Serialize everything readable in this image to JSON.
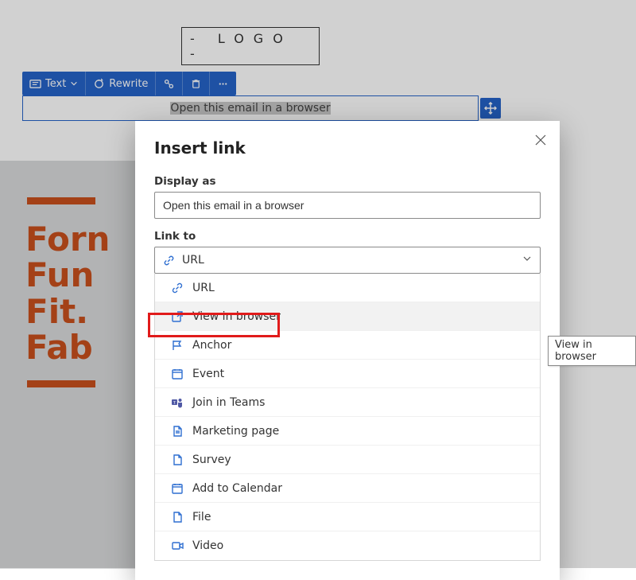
{
  "background": {
    "logo_text": "- LOGO -",
    "text_block_content": "Open this email in a browser",
    "hero_lines": [
      "Forn",
      "Fun",
      "Fit.",
      "Fab"
    ]
  },
  "toolbar": {
    "text_btn": "Text",
    "rewrite_btn": "Rewrite"
  },
  "dialog": {
    "title": "Insert link",
    "display_as_label": "Display as",
    "display_as_value": "Open this email in a browser",
    "link_to_label": "Link to",
    "selected_option": "URL",
    "options": [
      {
        "key": "url",
        "label": "URL"
      },
      {
        "key": "view_in_browser",
        "label": "View in browser"
      },
      {
        "key": "anchor",
        "label": "Anchor"
      },
      {
        "key": "event",
        "label": "Event"
      },
      {
        "key": "join_in_teams",
        "label": "Join in Teams"
      },
      {
        "key": "marketing_page",
        "label": "Marketing page"
      },
      {
        "key": "survey",
        "label": "Survey"
      },
      {
        "key": "add_to_calendar",
        "label": "Add to Calendar"
      },
      {
        "key": "file",
        "label": "File"
      },
      {
        "key": "video",
        "label": "Video"
      }
    ]
  },
  "tooltip": {
    "text": "View in browser"
  },
  "colors": {
    "primary_blue": "#2563c9",
    "link_icon_blue": "#2f6fd1",
    "accent_orange": "#c8501d",
    "highlight_red": "#e11b1b"
  }
}
